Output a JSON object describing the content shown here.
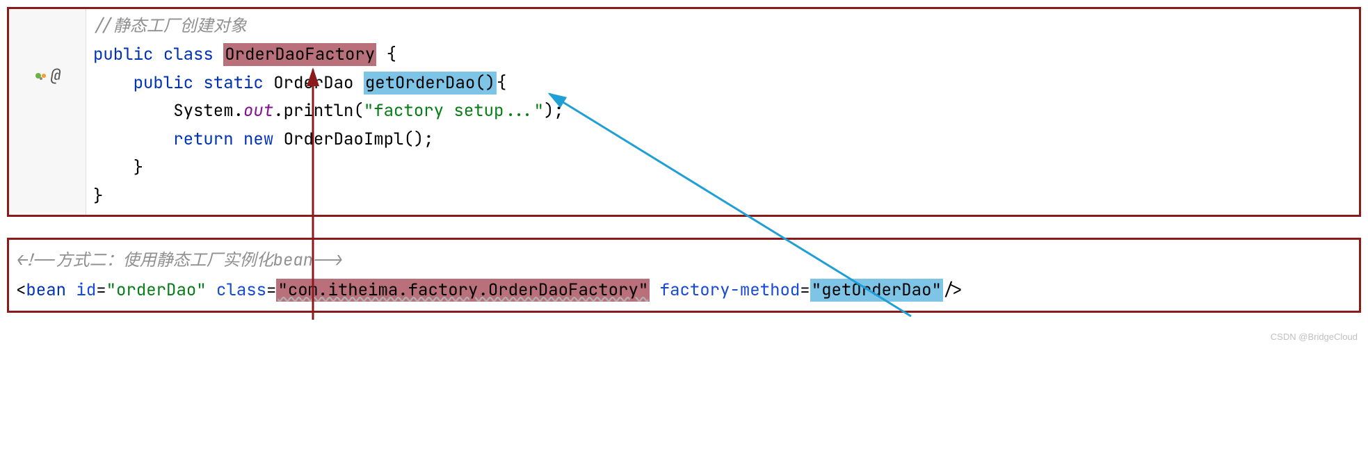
{
  "java": {
    "comment": "//静态工厂创建对象",
    "kw_public1": "public",
    "kw_class": "class",
    "class_name": "OrderDaoFactory",
    "brace_open1": " {",
    "kw_public2": "public",
    "kw_static": "static",
    "return_type": "OrderDao",
    "method_name": "getOrderDao()",
    "brace_open2": "{",
    "sysout_class": "System.",
    "sysout_field": "out",
    "sysout_method": ".println(",
    "string_literal": "\"factory setup...\"",
    "close_paren": ");",
    "kw_return": "return",
    "kw_new": "new",
    "impl_call": "OrderDaoImpl();",
    "brace_close1": "}",
    "brace_close2": "}",
    "gutter_at": "@"
  },
  "xml": {
    "comment": "<!--方式二：使用静态工厂实例化bean-->",
    "open": "<",
    "tag": "bean",
    "attr_id": "id",
    "eq": "=",
    "val_id": "\"orderDao\"",
    "attr_class": "class",
    "val_class": "\"com.itheima.factory.OrderDaoFactory\"",
    "attr_fm": "factory-method",
    "val_fm": "\"getOrderDao\"",
    "close": "/>"
  },
  "watermark": "CSDN @BridgeCloud"
}
